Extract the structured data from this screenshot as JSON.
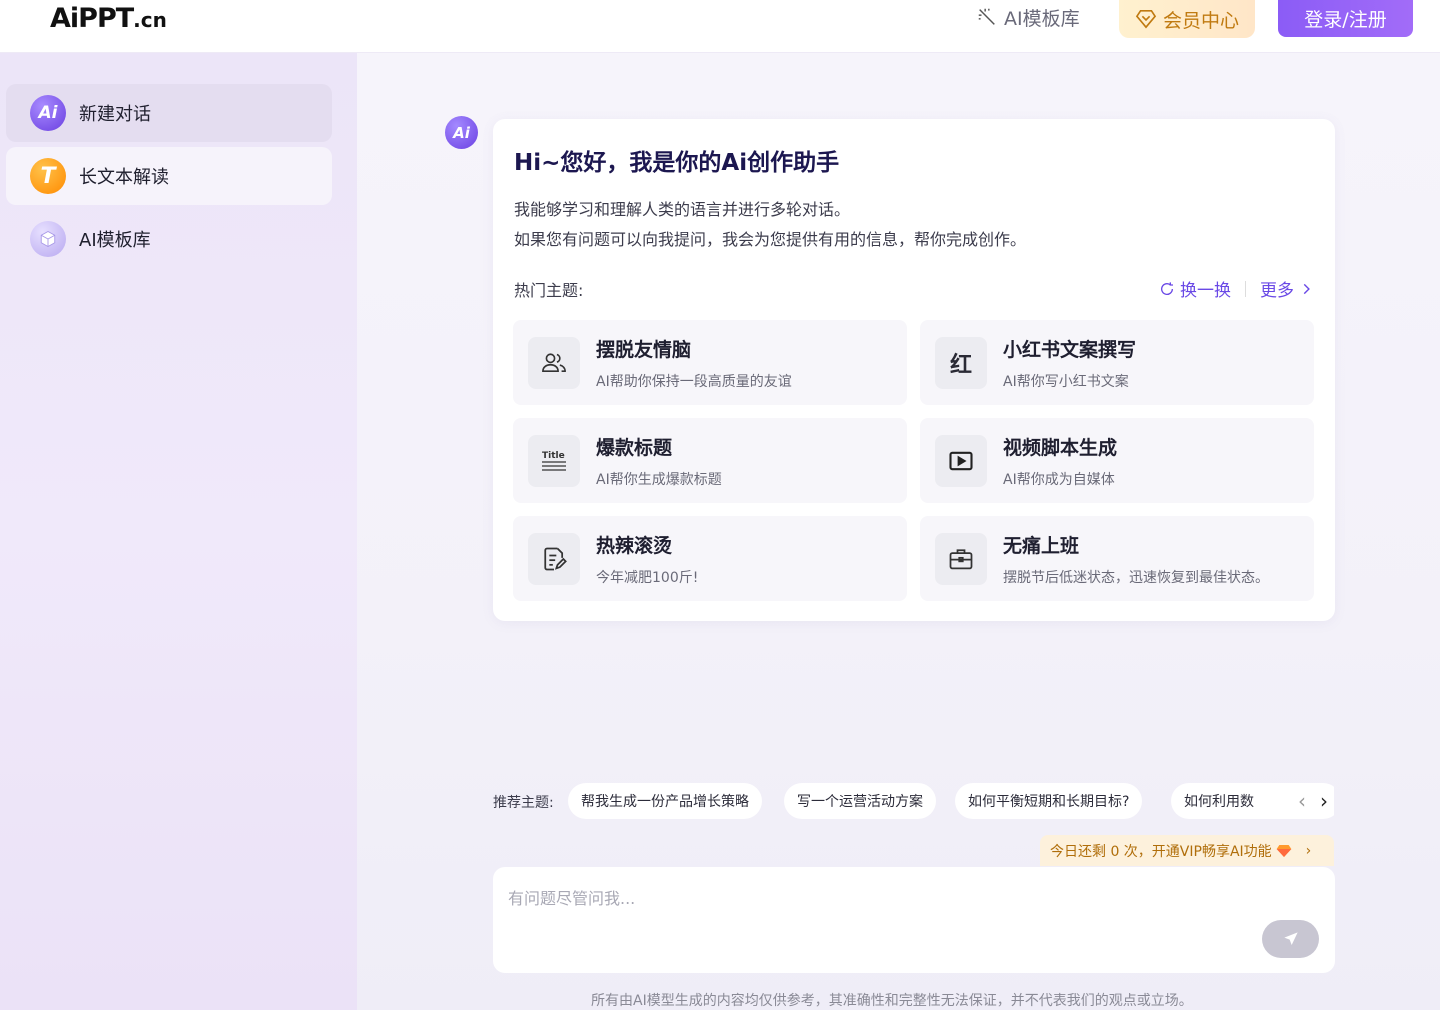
{
  "header": {
    "logo_main": "AiPPT",
    "logo_cn": ".cn",
    "templates_link": "AI模板库",
    "vip_label": "会员中心",
    "login_label": "登录/注册"
  },
  "sidebar": {
    "items": [
      {
        "label": "新建对话",
        "icon": "ai-chat-icon"
      },
      {
        "label": "长文本解读",
        "icon": "t-letter-icon"
      },
      {
        "label": "AI模板库",
        "icon": "box-icon"
      }
    ],
    "icon_text": {
      "ai": "Ai",
      "t": "T"
    }
  },
  "welcome": {
    "avatar_text": "Ai",
    "title": "Hi~您好，我是你的Ai创作助手",
    "desc_line1": "我能够学习和理解人类的语言并进行多轮对话。",
    "desc_line2": "如果您有问题可以向我提问，我会为您提供有用的信息，帮你完成创作。",
    "hot_label": "热门主题:",
    "shuffle_label": "换一换",
    "more_label": "更多"
  },
  "topics": [
    {
      "title": "摆脱友情脑",
      "sub": "AI帮助你保持一段高质量的友谊",
      "icon": "people-icon"
    },
    {
      "title": "小红书文案撰写",
      "sub": "AI帮你写小红书文案",
      "icon": "hong-icon",
      "icon_text": "红"
    },
    {
      "title": "爆款标题",
      "sub": "AI帮你生成爆款标题",
      "icon": "title-icon",
      "icon_text": "Title"
    },
    {
      "title": "视频脚本生成",
      "sub": "AI帮你成为自媒体",
      "icon": "video-icon"
    },
    {
      "title": "热辣滚烫",
      "sub": "今年减肥100斤!",
      "icon": "document-edit-icon"
    },
    {
      "title": "无痛上班",
      "sub": "摆脱节后低迷状态，迅速恢复到最佳状态。",
      "icon": "briefcase-icon"
    }
  ],
  "recommend": {
    "label": "推荐主题:",
    "chips": [
      "帮我生成一份产品增长策略",
      "写一个运营活动方案",
      "如何平衡短期和长期目标?",
      "如何利用数"
    ]
  },
  "quota": {
    "text": "今日还剩 0 次，开通VIP畅享AI功能"
  },
  "input": {
    "placeholder": "有问题尽管问我..."
  },
  "disclaimer": "所有由AI模型生成的内容均仅供参考，其准确性和完整性无法保证，并不代表我们的观点或立场。",
  "colors": {
    "accent": "#7c4dff",
    "vip_text": "#c07a10",
    "login_bg": "#8b5cf6"
  }
}
